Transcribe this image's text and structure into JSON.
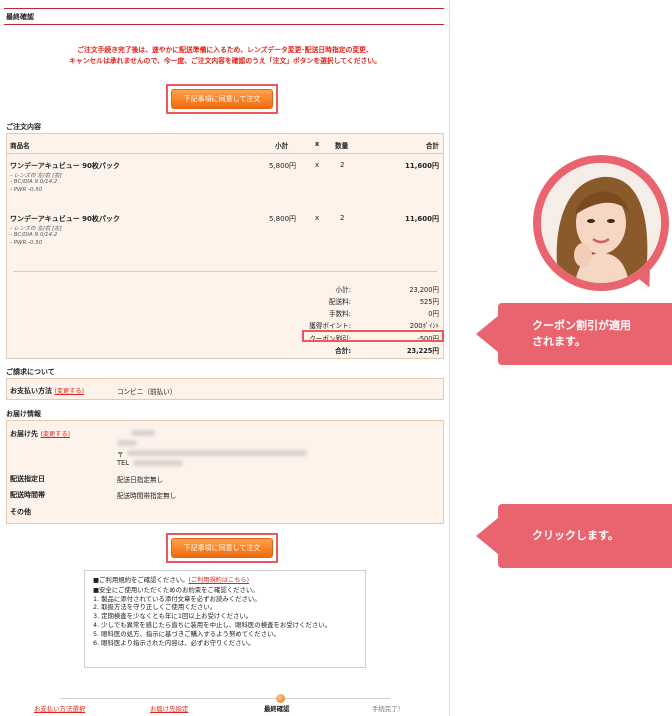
{
  "page": {
    "title": "最終確認"
  },
  "warning": {
    "line1": "ご注文手続き完了後は、速やかに配送準備に入るため、レンズデータ変更･配送日時指定の変更、",
    "line2": "キャンセルは承れませんので、今一度、ご注文内容を確認のうえ「注文」ボタンを選択してください。"
  },
  "confirm_button_label": "下記事項に同意して注文",
  "order": {
    "section_title": "ご注文内容",
    "headers": {
      "name": "商品名",
      "subtotal": "小計",
      "x": "x",
      "qty": "数量",
      "total": "合計"
    },
    "items": [
      {
        "name": "ワンデーアキュビュー 90枚パック",
        "details": [
          "- レンズの 左/右 [右]",
          "- BC/DIA 9.0/14.2",
          "- PWR -0.50"
        ],
        "price": "5,800円",
        "x": "x",
        "qty": "2",
        "total": "11,600円"
      },
      {
        "name": "ワンデーアキュビュー 90枚パック",
        "details": [
          "- レンズの 左/右 [左]",
          "- BC/DIA 9.0/14.2",
          "- PWR -0.50"
        ],
        "price": "5,800円",
        "x": "x",
        "qty": "2",
        "total": "11,600円"
      }
    ],
    "summary": [
      {
        "label": "小計:",
        "value": "23,200円"
      },
      {
        "label": "配送料:",
        "value": "525円"
      },
      {
        "label": "手数料:",
        "value": "0円"
      },
      {
        "label": "獲得ポイント:",
        "value": "200ﾎﾟｲﾝﾄ"
      },
      {
        "label": "クーポン割引:",
        "value": "-500円"
      },
      {
        "label": "合計:",
        "value": "23,225円"
      }
    ]
  },
  "billing": {
    "section_title": "ご請求について",
    "payment_label": "お支払い方法",
    "change_link": "(変更する)",
    "payment_value": "コンビニ（前払い）"
  },
  "delivery": {
    "section_title": "お届け情報",
    "address_label": "お届け先",
    "change_link": "(変更する)",
    "tel_prefix": "TEL",
    "postal_prefix": "〒",
    "date_label": "配送指定日",
    "date_value": "配送日指定無し",
    "time_label": "配送時間帯",
    "time_value": "配送時間帯指定無し",
    "other_label": "その他"
  },
  "terms": {
    "line1": "■ご利用規約をご確認ください。",
    "link": "(ご利用規約はこちら)",
    "items": [
      "■安全にご使用いただくためのお約束をご確認ください。",
      "1. 製品に添付されている添付文章を必ずお読みください。",
      "2. 取扱方法を守り正しくご使用ください。",
      "3. 定期検査を少なくとも年に1回以上お受けください。",
      "4. 少しでも異常を感じたら直ちに装用を中止し、眼科医の検査をお受けください。",
      "5. 眼科医の処方、指示に基づきご購入するよう努めてください。",
      "6. 眼科医より指示された内容は、必ずお守りください。"
    ]
  },
  "steps": [
    {
      "label": "お支払い方法選択",
      "state": "link"
    },
    {
      "label": "お届け先指定",
      "state": "link"
    },
    {
      "label": "最終確認",
      "state": "current"
    },
    {
      "label": "手続完了！",
      "state": "pending"
    }
  ],
  "annotations": {
    "coupon_note": {
      "line1": "クーポン割引が適用",
      "line2": "されます。"
    },
    "click_note": "クリックします。"
  },
  "colors": {
    "accent_red": "#e0241a",
    "callout_pink": "#e9646f",
    "button_orange": "#f06a0f",
    "box_bg": "#fdf3eb"
  }
}
